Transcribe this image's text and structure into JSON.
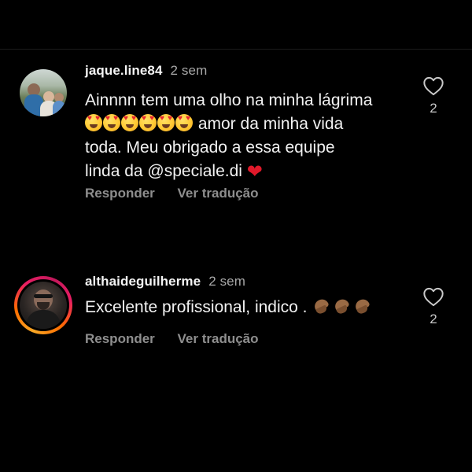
{
  "comments": [
    {
      "username": "jaque.line84",
      "time": "2 sem",
      "text_line1": "Ainnnn tem uma olho na minha lágrima",
      "text_line2_suffix": " amor da minha vida",
      "text_line3": "toda. Meu obrigado a essa equipe",
      "text_line4": "linda da @speciale.di",
      "reply_label": "Responder",
      "translate_label": "Ver tradução",
      "likes": "2",
      "emojis": [
        "heart-eyes-emoji",
        "heart-eyes-emoji",
        "heart-eyes-emoji",
        "heart-eyes-emoji",
        "heart-eyes-emoji",
        "heart-eyes-emoji",
        "red-heart-emoji"
      ]
    },
    {
      "username": "althaideguilherme",
      "time": "2 sem",
      "text": "Excelente profissional, indico .",
      "reply_label": "Responder",
      "translate_label": "Ver tradução",
      "likes": "2",
      "emojis": [
        "folded-hands-emoji",
        "folded-hands-emoji",
        "folded-hands-emoji"
      ],
      "story_ring": true
    }
  ],
  "colors": {
    "background": "#000000",
    "text": "#f5f5f5",
    "muted": "#a8a8a8",
    "action": "#8e8e8e",
    "story_ring": [
      "#f9a825",
      "#ff6d00",
      "#e91e63"
    ]
  },
  "icons": {
    "like": "heart-outline-icon"
  }
}
